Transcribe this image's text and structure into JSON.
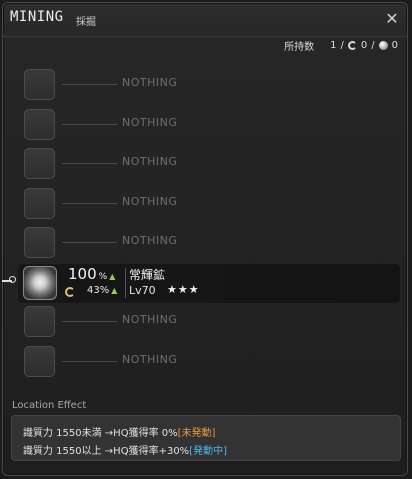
{
  "window": {
    "title": "MINING",
    "subtitle": "採掘",
    "close_icon": "close-icon"
  },
  "owned": {
    "label": "所持数",
    "nq_count": "1",
    "nq_sep": "/",
    "hq_count": "0",
    "hq_sep": "/",
    "collectable_count": "0"
  },
  "slots": [
    {
      "label": "NOTHING"
    },
    {
      "label": "NOTHING"
    },
    {
      "label": "NOTHING"
    },
    {
      "label": "NOTHING"
    },
    {
      "label": "NOTHING"
    },
    {
      "label": "NOTHING"
    },
    {
      "label": "NOTHING"
    }
  ],
  "active_item": {
    "gather_rate": "100",
    "hq_rate": "43",
    "percent": "%",
    "up_arrow": "▲",
    "name": "常輝鉱",
    "level": "Lv70",
    "stars": "★★★"
  },
  "location_effect": {
    "title": "Location Effect",
    "line1_text": "識質力 1550未満 →HQ獲得率 0%",
    "line1_tag": "[未発動]",
    "line2_text": "識質力 1550以上 →HQ獲得率+30%",
    "line2_tag": "[発動中]"
  }
}
